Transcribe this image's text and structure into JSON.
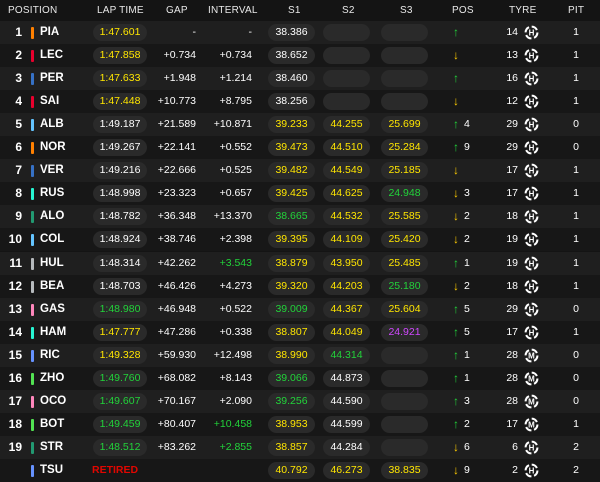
{
  "colors": {
    "white": "#ffffff",
    "yellow": "#ffe600",
    "green": "#22d33a",
    "purple": "#d048ff",
    "red": "#e10600",
    "up": "#22d33a",
    "down": "#ffcc00",
    "team": {
      "mclaren": "#ff8000",
      "ferrari": "#e8002d",
      "redbull": "#3671c6",
      "williams": "#64c4ff",
      "astonmartin": "#229971",
      "alpine": "#ff87bc",
      "haas": "#b6babd",
      "mercedes": "#27f4d2",
      "rb": "#6692ff",
      "sauber": "#52e252"
    }
  },
  "headers": {
    "position": "POSITION",
    "lap_time": "LAP TIME",
    "gap": "GAP",
    "interval": "INTERVAL",
    "s1": "S1",
    "s2": "S2",
    "s3": "S3",
    "pos": "POS",
    "tyre": "TYRE",
    "pit": "PIT"
  },
  "rows": [
    {
      "position": "1",
      "driver": "PIA",
      "team": "mclaren",
      "lap_time": "1:47.601",
      "lap_color": "yellow",
      "gap": "-",
      "interval": "-",
      "interval_color": "white",
      "s1": "38.386",
      "s1_color": "white",
      "s2": "",
      "s2_color": "white",
      "s3": "",
      "s3_color": "white",
      "pos_dir": "up",
      "pos_change": "",
      "laps": "14",
      "tyre_icon": "hard-tyre-icon",
      "tyre_letter": "H",
      "pit": "1"
    },
    {
      "position": "2",
      "driver": "LEC",
      "team": "ferrari",
      "lap_time": "1:47.858",
      "lap_color": "yellow",
      "gap": "+0.734",
      "interval": "+0.734",
      "interval_color": "white",
      "s1": "38.652",
      "s1_color": "white",
      "s2": "",
      "s2_color": "white",
      "s3": "",
      "s3_color": "white",
      "pos_dir": "down",
      "pos_change": "",
      "laps": "13",
      "tyre_icon": "hard-tyre-icon",
      "tyre_letter": "H",
      "pit": "1"
    },
    {
      "position": "3",
      "driver": "PER",
      "team": "redbull",
      "lap_time": "1:47.633",
      "lap_color": "yellow",
      "gap": "+1.948",
      "interval": "+1.214",
      "interval_color": "white",
      "s1": "38.460",
      "s1_color": "white",
      "s2": "",
      "s2_color": "white",
      "s3": "",
      "s3_color": "white",
      "pos_dir": "up",
      "pos_change": "",
      "laps": "16",
      "tyre_icon": "hard-tyre-icon",
      "tyre_letter": "H",
      "pit": "1"
    },
    {
      "position": "4",
      "driver": "SAI",
      "team": "ferrari",
      "lap_time": "1:47.448",
      "lap_color": "yellow",
      "gap": "+10.773",
      "interval": "+8.795",
      "interval_color": "white",
      "s1": "38.256",
      "s1_color": "white",
      "s2": "",
      "s2_color": "white",
      "s3": "",
      "s3_color": "white",
      "pos_dir": "down",
      "pos_change": "",
      "laps": "12",
      "tyre_icon": "hard-tyre-icon",
      "tyre_letter": "H",
      "pit": "1"
    },
    {
      "position": "5",
      "driver": "ALB",
      "team": "williams",
      "lap_time": "1:49.187",
      "lap_color": "white",
      "gap": "+21.589",
      "interval": "+10.871",
      "interval_color": "white",
      "s1": "39.233",
      "s1_color": "yellow",
      "s2": "44.255",
      "s2_color": "yellow",
      "s3": "25.699",
      "s3_color": "yellow",
      "pos_dir": "up",
      "pos_change": "4",
      "laps": "29",
      "tyre_icon": "hard-tyre-icon",
      "tyre_letter": "H",
      "pit": "0"
    },
    {
      "position": "6",
      "driver": "NOR",
      "team": "mclaren",
      "lap_time": "1:49.267",
      "lap_color": "white",
      "gap": "+22.141",
      "interval": "+0.552",
      "interval_color": "white",
      "s1": "39.473",
      "s1_color": "yellow",
      "s2": "44.510",
      "s2_color": "yellow",
      "s3": "25.284",
      "s3_color": "yellow",
      "pos_dir": "up",
      "pos_change": "9",
      "laps": "29",
      "tyre_icon": "hard-tyre-icon",
      "tyre_letter": "H",
      "pit": "0"
    },
    {
      "position": "7",
      "driver": "VER",
      "team": "redbull",
      "lap_time": "1:49.216",
      "lap_color": "white",
      "gap": "+22.666",
      "interval": "+0.525",
      "interval_color": "white",
      "s1": "39.482",
      "s1_color": "yellow",
      "s2": "44.549",
      "s2_color": "yellow",
      "s3": "25.185",
      "s3_color": "yellow",
      "pos_dir": "down",
      "pos_change": "",
      "laps": "17",
      "tyre_icon": "hard-tyre-icon",
      "tyre_letter": "H",
      "pit": "1"
    },
    {
      "position": "8",
      "driver": "RUS",
      "team": "mercedes",
      "lap_time": "1:48.998",
      "lap_color": "white",
      "gap": "+23.323",
      "interval": "+0.657",
      "interval_color": "white",
      "s1": "39.425",
      "s1_color": "yellow",
      "s2": "44.625",
      "s2_color": "yellow",
      "s3": "24.948",
      "s3_color": "green",
      "pos_dir": "down",
      "pos_change": "3",
      "laps": "17",
      "tyre_icon": "hard-tyre-icon",
      "tyre_letter": "H",
      "pit": "1"
    },
    {
      "position": "9",
      "driver": "ALO",
      "team": "astonmartin",
      "lap_time": "1:48.782",
      "lap_color": "white",
      "gap": "+36.348",
      "interval": "+13.370",
      "interval_color": "white",
      "s1": "38.665",
      "s1_color": "green",
      "s2": "44.532",
      "s2_color": "yellow",
      "s3": "25.585",
      "s3_color": "yellow",
      "pos_dir": "down",
      "pos_change": "2",
      "laps": "18",
      "tyre_icon": "hard-tyre-icon",
      "tyre_letter": "H",
      "pit": "1"
    },
    {
      "position": "10",
      "driver": "COL",
      "team": "williams",
      "lap_time": "1:48.924",
      "lap_color": "white",
      "gap": "+38.746",
      "interval": "+2.398",
      "interval_color": "white",
      "s1": "39.395",
      "s1_color": "yellow",
      "s2": "44.109",
      "s2_color": "yellow",
      "s3": "25.420",
      "s3_color": "yellow",
      "pos_dir": "down",
      "pos_change": "2",
      "laps": "19",
      "tyre_icon": "hard-tyre-icon",
      "tyre_letter": "H",
      "pit": "1"
    },
    {
      "position": "11",
      "driver": "HUL",
      "team": "haas",
      "lap_time": "1:48.314",
      "lap_color": "white",
      "gap": "+42.262",
      "interval": "+3.543",
      "interval_color": "green",
      "s1": "38.879",
      "s1_color": "yellow",
      "s2": "43.950",
      "s2_color": "yellow",
      "s3": "25.485",
      "s3_color": "yellow",
      "pos_dir": "up",
      "pos_change": "1",
      "laps": "19",
      "tyre_icon": "hard-tyre-icon",
      "tyre_letter": "H",
      "pit": "1"
    },
    {
      "position": "12",
      "driver": "BEA",
      "team": "haas",
      "lap_time": "1:48.703",
      "lap_color": "white",
      "gap": "+46.426",
      "interval": "+4.273",
      "interval_color": "white",
      "s1": "39.320",
      "s1_color": "yellow",
      "s2": "44.203",
      "s2_color": "yellow",
      "s3": "25.180",
      "s3_color": "green",
      "pos_dir": "down",
      "pos_change": "2",
      "laps": "18",
      "tyre_icon": "hard-tyre-icon",
      "tyre_letter": "H",
      "pit": "1"
    },
    {
      "position": "13",
      "driver": "GAS",
      "team": "alpine",
      "lap_time": "1:48.980",
      "lap_color": "green",
      "gap": "+46.948",
      "interval": "+0.522",
      "interval_color": "white",
      "s1": "39.009",
      "s1_color": "green",
      "s2": "44.367",
      "s2_color": "yellow",
      "s3": "25.604",
      "s3_color": "yellow",
      "pos_dir": "up",
      "pos_change": "5",
      "laps": "29",
      "tyre_icon": "hard-tyre-icon",
      "tyre_letter": "H",
      "pit": "0"
    },
    {
      "position": "14",
      "driver": "HAM",
      "team": "mercedes",
      "lap_time": "1:47.777",
      "lap_color": "yellow",
      "gap": "+47.286",
      "interval": "+0.338",
      "interval_color": "white",
      "s1": "38.807",
      "s1_color": "yellow",
      "s2": "44.049",
      "s2_color": "yellow",
      "s3": "24.921",
      "s3_color": "purple",
      "pos_dir": "up",
      "pos_change": "5",
      "laps": "17",
      "tyre_icon": "hard-tyre-icon",
      "tyre_letter": "H",
      "pit": "1"
    },
    {
      "position": "15",
      "driver": "RIC",
      "team": "rb",
      "lap_time": "1:49.328",
      "lap_color": "yellow",
      "gap": "+59.930",
      "interval": "+12.498",
      "interval_color": "white",
      "s1": "38.990",
      "s1_color": "yellow",
      "s2": "44.314",
      "s2_color": "green",
      "s3": "",
      "s3_color": "white",
      "pos_dir": "up",
      "pos_change": "1",
      "laps": "28",
      "tyre_icon": "medium-tyre-icon",
      "tyre_letter": "M",
      "pit": "0"
    },
    {
      "position": "16",
      "driver": "ZHO",
      "team": "sauber",
      "lap_time": "1:49.760",
      "lap_color": "green",
      "gap": "+68.082",
      "interval": "+8.143",
      "interval_color": "white",
      "s1": "39.066",
      "s1_color": "green",
      "s2": "44.873",
      "s2_color": "white",
      "s3": "",
      "s3_color": "white",
      "pos_dir": "up",
      "pos_change": "1",
      "laps": "28",
      "tyre_icon": "medium-tyre-icon",
      "tyre_letter": "M",
      "pit": "0"
    },
    {
      "position": "17",
      "driver": "OCO",
      "team": "alpine",
      "lap_time": "1:49.607",
      "lap_color": "green",
      "gap": "+70.167",
      "interval": "+2.090",
      "interval_color": "white",
      "s1": "39.256",
      "s1_color": "green",
      "s2": "44.590",
      "s2_color": "white",
      "s3": "",
      "s3_color": "white",
      "pos_dir": "up",
      "pos_change": "3",
      "laps": "28",
      "tyre_icon": "medium-tyre-icon",
      "tyre_letter": "M",
      "pit": "0"
    },
    {
      "position": "18",
      "driver": "BOT",
      "team": "sauber",
      "lap_time": "1:49.459",
      "lap_color": "green",
      "gap": "+80.407",
      "interval": "+10.458",
      "interval_color": "green",
      "s1": "38.953",
      "s1_color": "yellow",
      "s2": "44.599",
      "s2_color": "white",
      "s3": "",
      "s3_color": "white",
      "pos_dir": "up",
      "pos_change": "2",
      "laps": "17",
      "tyre_icon": "medium-tyre-icon",
      "tyre_letter": "M",
      "pit": "1"
    },
    {
      "position": "19",
      "driver": "STR",
      "team": "astonmartin",
      "lap_time": "1:48.512",
      "lap_color": "green",
      "gap": "+83.262",
      "interval": "+2.855",
      "interval_color": "green",
      "s1": "38.857",
      "s1_color": "yellow",
      "s2": "44.284",
      "s2_color": "white",
      "s3": "",
      "s3_color": "white",
      "pos_dir": "down",
      "pos_change": "6",
      "laps": "6",
      "tyre_icon": "hard-tyre-icon",
      "tyre_letter": "H",
      "pit": "2"
    },
    {
      "position": "",
      "driver": "TSU",
      "team": "rb",
      "retired": "RETIRED",
      "lap_time": "",
      "lap_color": "white",
      "gap": "",
      "interval": "",
      "interval_color": "white",
      "s1": "40.792",
      "s1_color": "yellow",
      "s2": "46.273",
      "s2_color": "yellow",
      "s3": "38.835",
      "s3_color": "yellow",
      "pos_dir": "down",
      "pos_change": "9",
      "laps": "2",
      "tyre_icon": "hard-tyre-icon",
      "tyre_letter": "H",
      "pit": "2"
    }
  ]
}
